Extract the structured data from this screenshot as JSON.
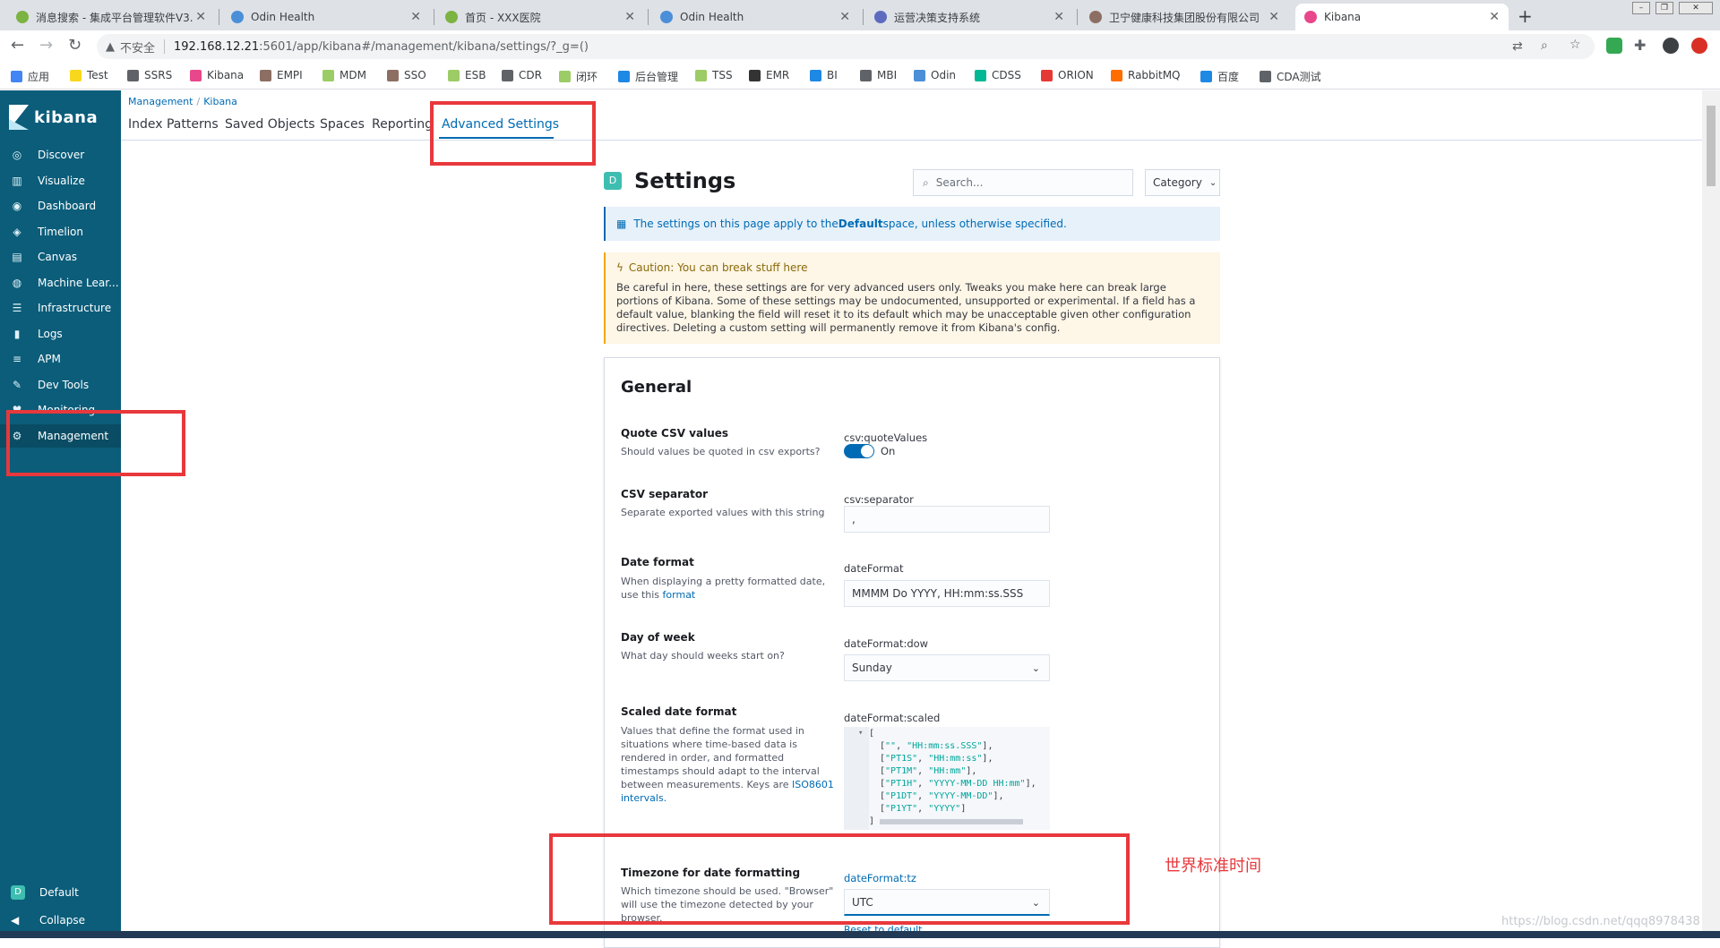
{
  "browser": {
    "tabs": [
      {
        "title": "消息搜索 - 集成平台管理软件V3.",
        "color": "#7cb342"
      },
      {
        "title": "Odin Health",
        "color": "#4a8fd8"
      },
      {
        "title": "首页 - XXX医院",
        "color": "#7cb342"
      },
      {
        "title": "Odin Health",
        "color": "#4a8fd8"
      },
      {
        "title": "运营决策支持系统",
        "color": "#5c6bc0"
      },
      {
        "title": "卫宁健康科技集团股份有限公司",
        "color": "#8d6e63"
      },
      {
        "title": "Kibana",
        "color": "#e8478b"
      }
    ],
    "new_tab": "+",
    "url_warning": "不安全",
    "url_host": "192.168.12.21",
    "url_path": ":5601/app/kibana#/management/kibana/settings/?_g=()",
    "bookmarks": [
      {
        "label": "应用",
        "color": "#4285f4"
      },
      {
        "label": "Test",
        "color": "#f9d71c"
      },
      {
        "label": "SSRS",
        "color": "#5f6368"
      },
      {
        "label": "Kibana",
        "color": "#e8478b"
      },
      {
        "label": "EMPI",
        "color": "#8d6e63"
      },
      {
        "label": "MDM",
        "color": "#9ccc65"
      },
      {
        "label": "SSO",
        "color": "#8d6e63"
      },
      {
        "label": "ESB",
        "color": "#9ccc65"
      },
      {
        "label": "CDR",
        "color": "#5f6368"
      },
      {
        "label": "闭环",
        "color": "#9ccc65"
      },
      {
        "label": "后台管理",
        "color": "#1e88e5"
      },
      {
        "label": "TSS",
        "color": "#9ccc65"
      },
      {
        "label": "EMR",
        "color": "#333333"
      },
      {
        "label": "BI",
        "color": "#1e88e5"
      },
      {
        "label": "MBI",
        "color": "#5f6368"
      },
      {
        "label": "Odin",
        "color": "#4a8fd8"
      },
      {
        "label": "CDSS",
        "color": "#00b894"
      },
      {
        "label": "ORION",
        "color": "#e53935"
      },
      {
        "label": "RabbitMQ",
        "color": "#ff6d00"
      },
      {
        "label": "百度",
        "color": "#1e88e5"
      },
      {
        "label": "CDA测试",
        "color": "#5f6368"
      }
    ]
  },
  "kibana": {
    "logo": "kibana",
    "nav": [
      {
        "label": "Discover",
        "icon": "compass-icon",
        "glyph": "◎"
      },
      {
        "label": "Visualize",
        "icon": "chart-icon",
        "glyph": "▥"
      },
      {
        "label": "Dashboard",
        "icon": "dashboard-icon",
        "glyph": "◉"
      },
      {
        "label": "Timelion",
        "icon": "shield-icon",
        "glyph": "◈"
      },
      {
        "label": "Canvas",
        "icon": "canvas-icon",
        "glyph": "▤"
      },
      {
        "label": "Machine Lear...",
        "icon": "ml-icon",
        "glyph": "◍"
      },
      {
        "label": "Infrastructure",
        "icon": "infra-icon",
        "glyph": "☰"
      },
      {
        "label": "Logs",
        "icon": "logs-icon",
        "glyph": "▮"
      },
      {
        "label": "APM",
        "icon": "apm-icon",
        "glyph": "≡"
      },
      {
        "label": "Dev Tools",
        "icon": "wrench-icon",
        "glyph": "✎"
      },
      {
        "label": "Monitoring",
        "icon": "heart-icon",
        "glyph": "♥"
      },
      {
        "label": "Management",
        "icon": "gear-icon",
        "glyph": "⚙"
      }
    ],
    "space_badge": "D",
    "space_label": "Default",
    "collapse_label": "Collapse",
    "breadcrumb": [
      "Management",
      "Kibana"
    ],
    "tabs": [
      "Index Patterns",
      "Saved Objects",
      "Spaces",
      "Reporting",
      "Advanced Settings"
    ]
  },
  "settings": {
    "badge": "D",
    "title": "Settings",
    "search_placeholder": "Search...",
    "category_label": "Category",
    "info_prefix": "The settings on this page apply to the ",
    "info_bold": "Default",
    "info_suffix": " space, unless otherwise specified.",
    "warn_title": "Caution: You can break stuff here",
    "warn_body": "Be careful in here, these settings are for very advanced users only. Tweaks you make here can break large portions of Kibana. Some of these settings may be undocumented, unsupported or experimental. If a field has a default value, blanking the field will reset it to its default which may be unacceptable given other configuration directives. Deleting a custom setting will permanently remove it from Kibana's config.",
    "section": "General",
    "quote_csv": {
      "label": "Quote CSV values",
      "desc": "Should values be quoted in csv exports?",
      "key": "csv:quoteValues",
      "state": "On"
    },
    "csv_sep": {
      "label": "CSV separator",
      "desc": "Separate exported values with this string",
      "key": "csv:separator",
      "value": ","
    },
    "date_format": {
      "label": "Date format",
      "desc": "When displaying a pretty formatted date, use this ",
      "link": "format",
      "key": "dateFormat",
      "value": "MMMM Do YYYY, HH:mm:ss.SSS"
    },
    "day_of_week": {
      "label": "Day of week",
      "desc": "What day should weeks start on?",
      "key": "dateFormat:dow",
      "value": "Sunday"
    },
    "scaled": {
      "label": "Scaled date format",
      "desc": "Values that define the format used in situations where time-based data is rendered in order, and formatted timestamps should adapt to the interval between measurements. Keys are ",
      "link": "ISO8601 intervals.",
      "key": "dateFormat:scaled",
      "code_open": "[",
      "code_lines": [
        [
          "\"\"",
          "\"HH:mm:ss.SSS\""
        ],
        [
          "\"PT1S\"",
          "\"HH:mm:ss\""
        ],
        [
          "\"PT1M\"",
          "\"HH:mm\""
        ],
        [
          "\"PT1H\"",
          "\"YYYY-MM-DD HH:mm\""
        ],
        [
          "\"P1DT\"",
          "\"YYYY-MM-DD\""
        ],
        [
          "\"P1YT\"",
          "\"YYYY\""
        ]
      ],
      "code_close": "]"
    },
    "timezone": {
      "label": "Timezone for date formatting",
      "desc": "Which timezone should be used. \"Browser\" will use the timezone detected by your browser.",
      "key": "dateFormat:tz",
      "value": "UTC",
      "reset": "Reset to default"
    }
  },
  "annotation": "世界标准时间",
  "watermark": "https://blog.csdn.net/qqq8978438"
}
